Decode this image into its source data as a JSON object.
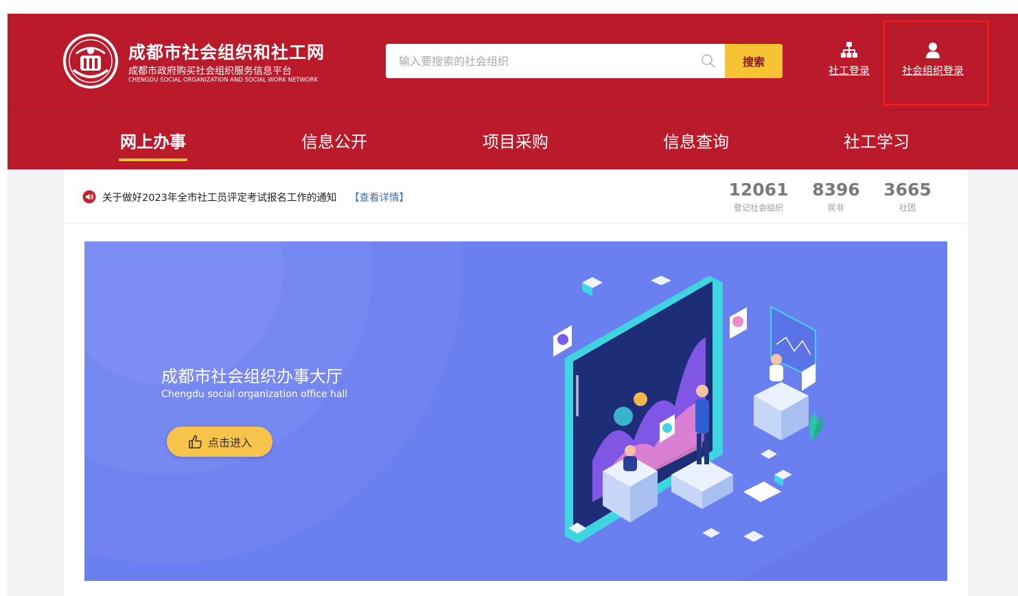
{
  "site": {
    "title": "成都市社会组织和社工网",
    "subtitle": "成都市政府购买社会组织服务信息平台",
    "subtitle_en": "CHENGDU SOCIAL ORGANIZATION AND SOCIAL WORK NETWORK"
  },
  "search": {
    "placeholder": "输入要搜索的社会组织",
    "button_label": "搜索"
  },
  "logins": {
    "social_worker": "社工登录",
    "organization": "社会组织登录"
  },
  "nav": {
    "items": [
      {
        "label": "网上办事"
      },
      {
        "label": "信息公开"
      },
      {
        "label": "项目采购"
      },
      {
        "label": "信息查询"
      },
      {
        "label": "社工学习"
      }
    ]
  },
  "notice": {
    "text": "关于做好2023年全市社工员评定考试报名工作的通知",
    "link": "【查看详情】"
  },
  "stats": [
    {
      "value": "12061",
      "label": "登记社会组织"
    },
    {
      "value": "8396",
      "label": "民非"
    },
    {
      "value": "3665",
      "label": "社团"
    }
  ],
  "banner": {
    "title": "成都市社会组织办事大厅",
    "subtitle": "Chengdu social organization office hall",
    "button_label": "点击进入"
  },
  "colors": {
    "header_red": "#bb1a2b",
    "accent_yellow": "#f7c233",
    "banner_blue": "#6a7ff0",
    "link_blue": "#2f6fd6"
  }
}
